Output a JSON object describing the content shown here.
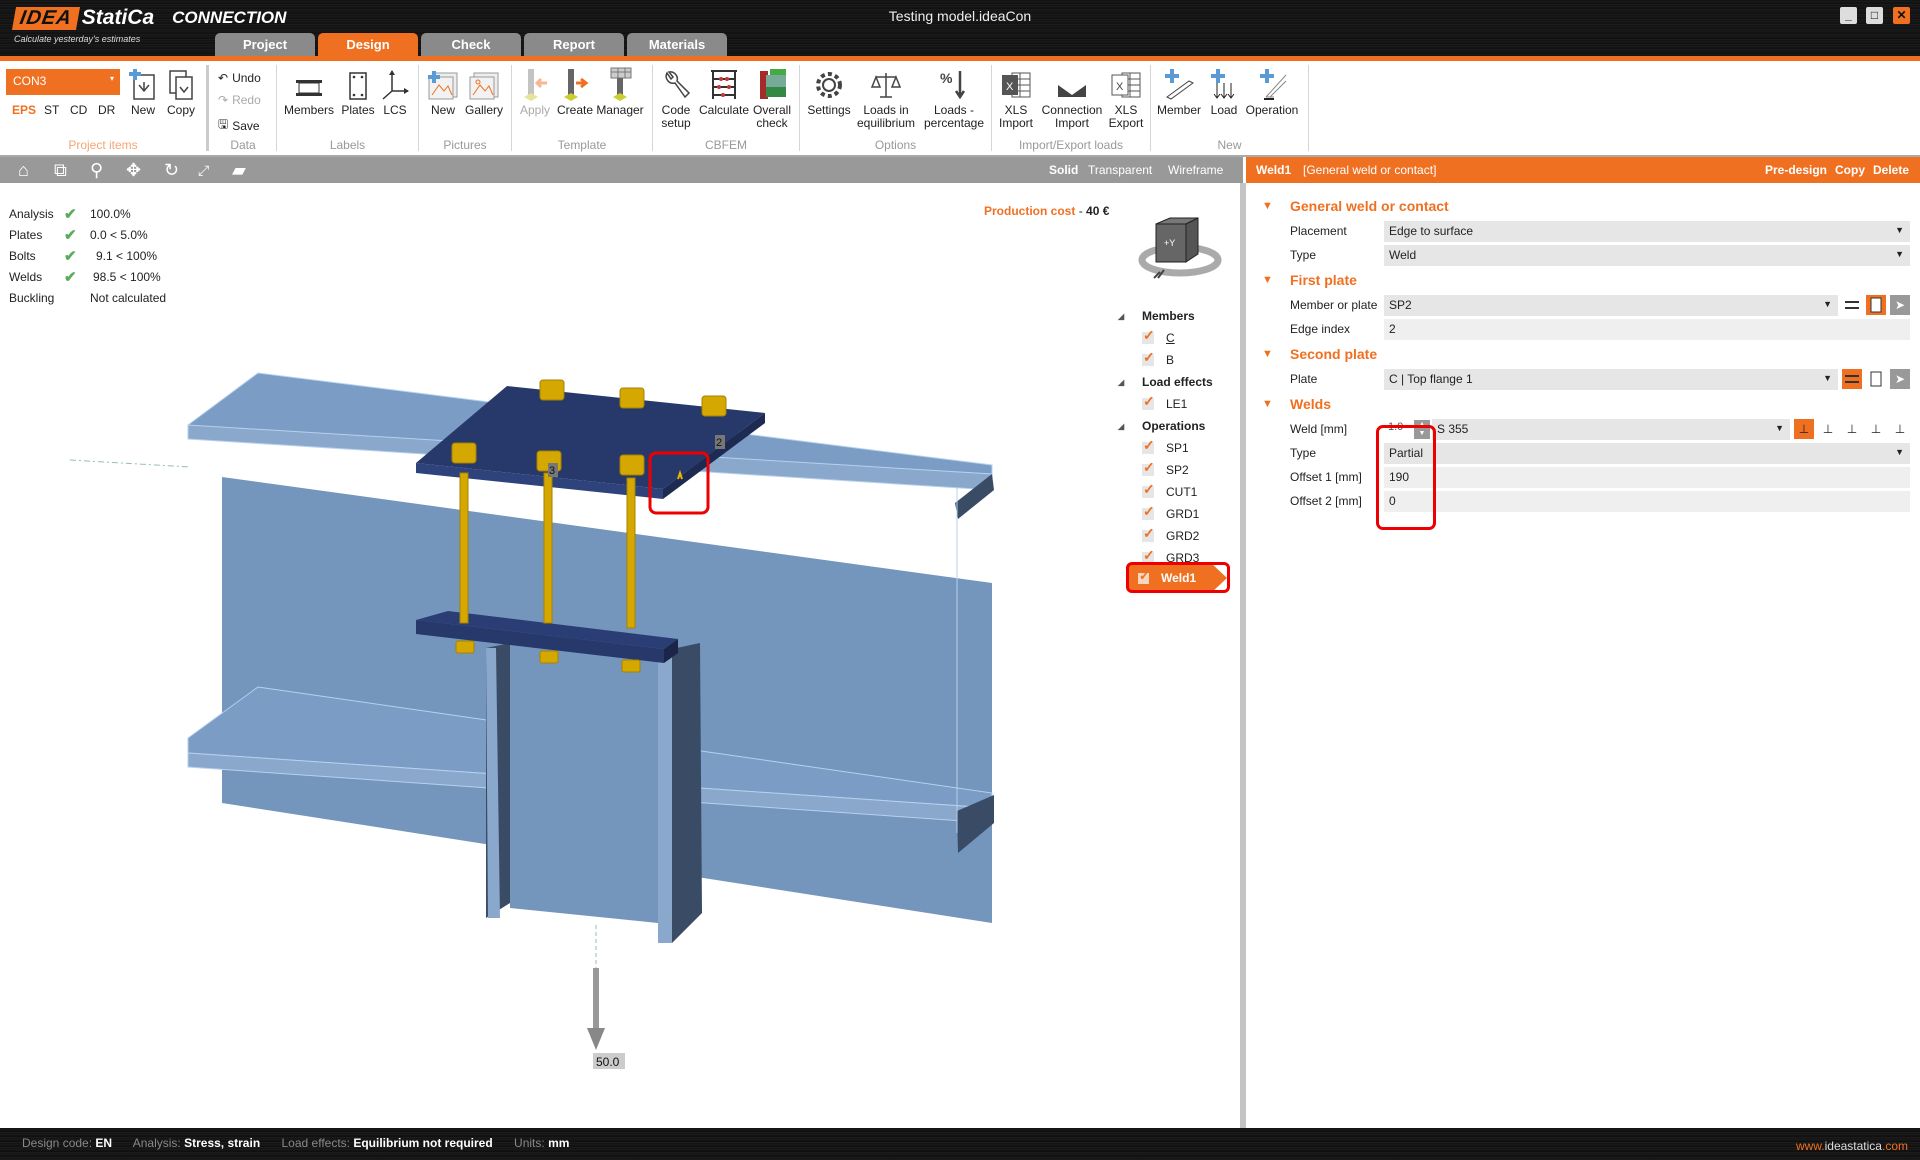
{
  "app": {
    "logo_box": "IDEA",
    "logo_name": "StatiCa",
    "logo_app": "CONNECTION",
    "tagline": "Calculate yesterday's estimates",
    "window_title": "Testing model.ideaCon",
    "window_buttons": [
      "minimize",
      "maximize",
      "close"
    ]
  },
  "tabs": [
    {
      "label": "Project",
      "active": false
    },
    {
      "label": "Design",
      "active": true
    },
    {
      "label": "Check",
      "active": false
    },
    {
      "label": "Report",
      "active": false
    },
    {
      "label": "Materials",
      "active": false
    }
  ],
  "ribbon": {
    "project_items": {
      "group_label": "Project items",
      "connection_selected": "CON3",
      "modes": [
        "EPS",
        "ST",
        "CD",
        "DR"
      ],
      "active_mode": "EPS",
      "new": "New",
      "copy": "Copy"
    },
    "data": {
      "group_label": "Data",
      "undo": "Undo",
      "redo": "Redo",
      "save": "Save"
    },
    "labels": {
      "group_label": "Labels",
      "members": "Members",
      "plates": "Plates",
      "lcs": "LCS"
    },
    "pictures": {
      "group_label": "Pictures",
      "new": "New",
      "gallery": "Gallery"
    },
    "template": {
      "group_label": "Template",
      "apply": "Apply",
      "create": "Create",
      "manager": "Manager"
    },
    "cbfem": {
      "group_label": "CBFEM",
      "code_setup": [
        "Code",
        "setup"
      ],
      "calculate": "Calculate",
      "overall_check": [
        "Overall",
        "check"
      ]
    },
    "options": {
      "group_label": "Options",
      "settings": "Settings",
      "loads_equilibrium": [
        "Loads in",
        "equilibrium"
      ],
      "loads_percentage": [
        "Loads -",
        "percentage"
      ]
    },
    "import_export": {
      "group_label": "Import/Export loads",
      "xls_import": [
        "XLS",
        "Import"
      ],
      "connection_import": [
        "Connection",
        "Import"
      ],
      "xls_export": [
        "XLS",
        "Export"
      ]
    },
    "new": {
      "group_label": "New",
      "member": "Member",
      "load": "Load",
      "operation": "Operation"
    }
  },
  "viewbar": {
    "tools": [
      "home-icon",
      "zoom-window-icon",
      "zoom-icon",
      "pan-icon",
      "rotate-icon",
      "fit-icon",
      "render-icon"
    ],
    "modes": [
      "Solid",
      "Transparent",
      "Wireframe"
    ],
    "active_mode": "Solid"
  },
  "checks": [
    {
      "label": "Analysis",
      "ok": true,
      "value": "100.0%"
    },
    {
      "label": "Plates",
      "ok": true,
      "value": "0.0 < 5.0%"
    },
    {
      "label": "Bolts",
      "ok": true,
      "value": "9.1 < 100%"
    },
    {
      "label": "Welds",
      "ok": true,
      "value": "98.5 < 100%"
    },
    {
      "label": "Buckling",
      "ok": false,
      "value": "Not calculated"
    }
  ],
  "production_cost": {
    "label": "Production cost",
    "sep": "-",
    "value": "40 €"
  },
  "viewcube": {
    "face": "+Y"
  },
  "model": {
    "edge_labels": [
      "2",
      "3"
    ],
    "load_value": "50.0"
  },
  "tree": {
    "groups": [
      {
        "label": "Members",
        "items": [
          "C",
          "B"
        ]
      },
      {
        "label": "Load effects",
        "items": [
          "LE1"
        ]
      },
      {
        "label": "Operations",
        "items": [
          "SP1",
          "SP2",
          "CUT1",
          "GRD1",
          "GRD2",
          "GRD3"
        ]
      }
    ],
    "selected": "Weld1"
  },
  "properties": {
    "header_name": "Weld1",
    "header_type": "[General weld or contact]",
    "actions": [
      "Pre-design",
      "Copy",
      "Delete"
    ],
    "sections": {
      "general": {
        "title": "General weld or contact",
        "placement_label": "Placement",
        "placement_value": "Edge to surface",
        "type_label": "Type",
        "type_value": "Weld"
      },
      "first_plate": {
        "title": "First plate",
        "member_label": "Member or plate",
        "member_value": "SP2",
        "edge_label": "Edge index",
        "edge_value": "2"
      },
      "second_plate": {
        "title": "Second plate",
        "plate_label": "Plate",
        "plate_value": "C | Top flange 1"
      },
      "welds": {
        "title": "Welds",
        "weld_label": "Weld [mm]",
        "weld_value": "1.0",
        "material_value": "S 355",
        "type_label": "Type",
        "type_value": "Partial",
        "offset1_label": "Offset 1 [mm]",
        "offset1_value": "190",
        "offset2_label": "Offset 2 [mm]",
        "offset2_value": "0"
      }
    }
  },
  "statusbar": {
    "design_code_label": "Design code:",
    "design_code": "EN",
    "analysis_label": "Analysis:",
    "analysis": "Stress, strain",
    "load_effects_label": "Load effects:",
    "load_effects": "Equilibrium not required",
    "units_label": "Units:",
    "units": "mm",
    "website_pre": "www.",
    "website_mid": "ideastatica",
    "website_post": ".com"
  },
  "colors": {
    "accent": "#f07022",
    "steel": "#7496bd",
    "plate": "#27386a",
    "bolt": "#e6b800",
    "highlight": "#e00000"
  }
}
